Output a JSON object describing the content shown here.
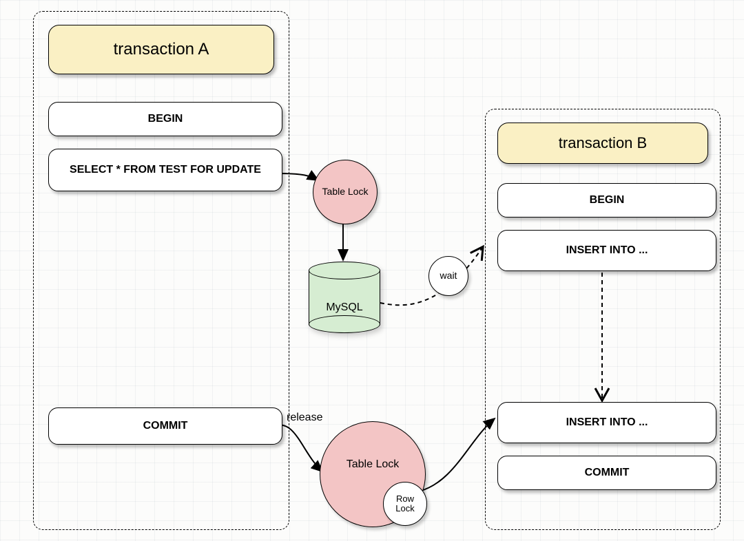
{
  "transactionA": {
    "title": "transaction A",
    "steps": {
      "begin": "BEGIN",
      "select": "SELECT * FROM TEST FOR UPDATE",
      "commit": "COMMIT"
    }
  },
  "transactionB": {
    "title": "transaction B",
    "steps": {
      "begin": "BEGIN",
      "insert1": "INSERT INTO ...",
      "insert2": "INSERT INTO ...",
      "commit": "COMMIT"
    }
  },
  "locks": {
    "tableLock1": "Table Lock",
    "tableLock2": "Table Lock",
    "rowLock": "Row\nLock"
  },
  "db": {
    "name": "MySQL"
  },
  "labels": {
    "wait": "wait",
    "release": "release"
  }
}
